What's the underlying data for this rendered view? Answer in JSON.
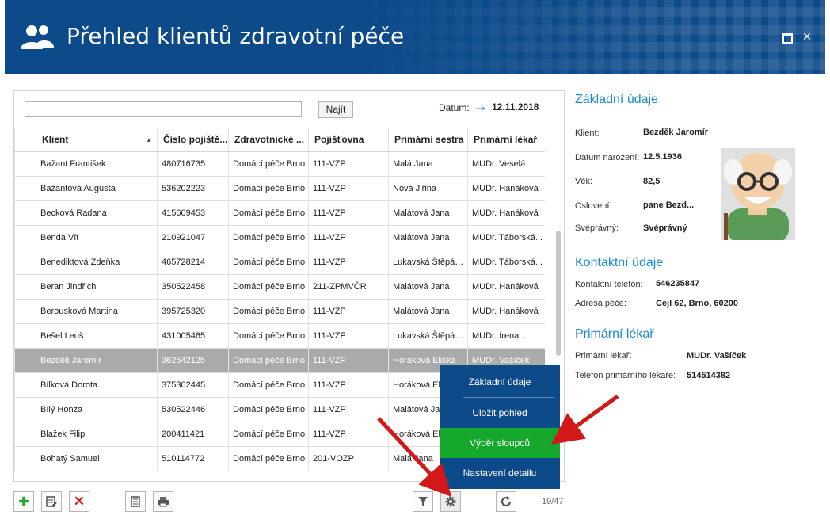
{
  "window": {
    "title": "Přehled klientů zdravotní péče"
  },
  "search": {
    "value": "",
    "button": "Najít",
    "date_label": "Datum:",
    "date_value": "12.11.2018"
  },
  "columns": [
    "Klient",
    "Číslo pojiště...",
    "Zdravotnické ...",
    "Pojišťovna",
    "Primární sestra",
    "Primární lékař"
  ],
  "rows": [
    [
      "Bažant František",
      "480716735",
      "Domácí péče Brno",
      "111-VZP",
      "Malá Jana",
      "MUDr. Veselá"
    ],
    [
      "Bažantová Augusta",
      "536202223",
      "Domácí péče Brno",
      "111-VZP",
      "Nová Jiřina",
      "MUDr. Hanáková"
    ],
    [
      "Becková Radana",
      "415609453",
      "Domácí péče Brno",
      "111-VZP",
      "Malátová Jana",
      "MUDr. Hanáková"
    ],
    [
      "Benda Vít",
      "210921047",
      "Domácí péče Brno",
      "111-VZP",
      "Malátová Jana",
      "MUDr. Táborská..."
    ],
    [
      "Benediktová Zdeňka",
      "465728214",
      "Domácí péče Brno",
      "111-VZP",
      "Lukavská Štěpánka",
      "MUDr. Táborská..."
    ],
    [
      "Beran Jindřich",
      "350522458",
      "Domácí péče Brno",
      "211-ZPMVČR",
      "Malátová Jana",
      "MUDr. Hanáková"
    ],
    [
      "Berousková Martina",
      "395725320",
      "Domácí péče Brno",
      "111-VZP",
      "Malátová Jana",
      "MUDr. Hanáková"
    ],
    [
      "Bešel Leoš",
      "431005465",
      "Domácí péče Brno",
      "111-VZP",
      "Lukavská Štěpánka",
      "MUDr. Irena..."
    ],
    [
      "Bezděk Jaromír",
      "362542125",
      "Domácí péče Brno",
      "111-VZP",
      "Horáková Eliška",
      "MUDr. Vašíček"
    ],
    [
      "Bílková Dorota",
      "375302445",
      "Domácí péče Brno",
      "111-VZP",
      "Horáková Eliška",
      ""
    ],
    [
      "Bílý Honza",
      "530522446",
      "Domácí péče Brno",
      "111-VZP",
      "Malátová Jana",
      ""
    ],
    [
      "Blažek Filip",
      "200411421",
      "Domácí péče Brno",
      "111-VZP",
      "Horáková Eliška",
      ""
    ],
    [
      "Bohatý Samuel",
      "510114772",
      "Domácí péče Brno",
      "201-VOZP",
      "Malá Jana",
      ""
    ]
  ],
  "selected_row": 8,
  "count": "19/47",
  "menu": {
    "items": [
      "Základní údaje",
      "Uložit pohled",
      "Výběr sloupců",
      "Nastavení detailu"
    ],
    "active_index": 2
  },
  "detail": {
    "basic_title": "Základní údaje",
    "client_label": "Klient:",
    "client_value": "Bezděk Jaromír",
    "birth_label": "Datum narození:",
    "birth_value": "12.5.1936",
    "age_label": "Věk:",
    "age_value": "82,5",
    "address_label": "Oslovení:",
    "address_value": "pane Bezd...",
    "competent_label": "Svéprávný:",
    "competent_value": "Svéprávný",
    "contact_title": "Kontaktní údaje",
    "phone_label": "Kontaktní telefon:",
    "phone_value": "546235847",
    "care_address_label": "Adresa péče:",
    "care_address_value": "Cejl 62, Brno, 60200",
    "doctor_title": "Primární lékař",
    "doctor_label": "Primární lékař:",
    "doctor_value": "MUDr. Vašíček",
    "doctor_phone_label": "Telefon primárního lékaře:",
    "doctor_phone_value": "514514382"
  },
  "icons": {
    "add": "plus-icon",
    "edit": "edit-icon",
    "delete": "delete-icon",
    "report": "document-icon",
    "print": "print-icon",
    "filter": "filter-icon",
    "settings": "gear-icon",
    "refresh": "refresh-icon"
  },
  "colors": {
    "header": "#0d4a8a",
    "accent": "#1a8ad0",
    "menu_active": "#16a82c",
    "selected_row": "#aaaaaa"
  }
}
